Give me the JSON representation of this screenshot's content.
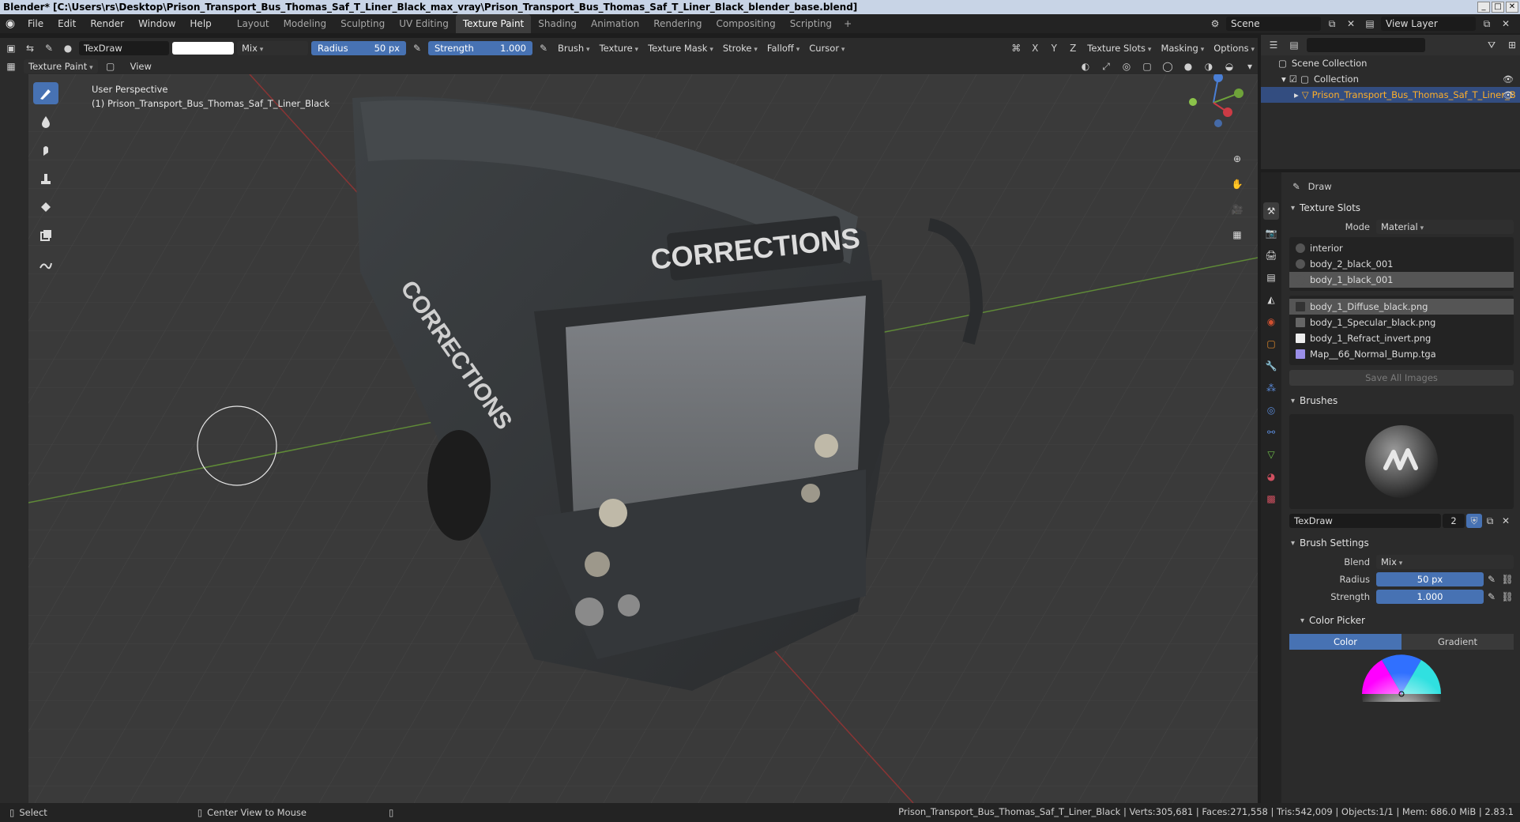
{
  "window": {
    "title": "Blender* [C:\\Users\\rs\\Desktop\\Prison_Transport_Bus_Thomas_Saf_T_Liner_Black_max_vray\\Prison_Transport_Bus_Thomas_Saf_T_Liner_Black_blender_base.blend]"
  },
  "menu": {
    "items": [
      "File",
      "Edit",
      "Render",
      "Window",
      "Help"
    ]
  },
  "workspaces": {
    "tabs": [
      "Layout",
      "Modeling",
      "Sculpting",
      "UV Editing",
      "Texture Paint",
      "Shading",
      "Animation",
      "Rendering",
      "Compositing",
      "Scripting"
    ],
    "active": "Texture Paint",
    "add_label": "+"
  },
  "scene": {
    "name": "Scene",
    "view_layer": "View Layer"
  },
  "toolheader": {
    "brush_name": "TexDraw",
    "blend": "Mix",
    "radius_label": "Radius",
    "radius_value": "50 px",
    "strength_label": "Strength",
    "strength_value": "1.000",
    "menus": [
      "Brush",
      "Texture",
      "Texture Mask",
      "Stroke",
      "Falloff",
      "Cursor"
    ],
    "axes": [
      "X",
      "Y",
      "Z"
    ],
    "right_menus": [
      "Texture Slots",
      "Masking",
      "Options"
    ]
  },
  "toolheader2": {
    "mode": "Texture Paint",
    "view": "View"
  },
  "viewport": {
    "perspective": "User Perspective",
    "object_label": "(1) Prison_Transport_Bus_Thomas_Saf_T_Liner_Black",
    "sign_text": "CORRECTIONS",
    "side_text": "CORRECTIONS"
  },
  "outliner": {
    "scene_collection": "Scene Collection",
    "collection": "Collection",
    "object": "Prison_Transport_Bus_Thomas_Saf_T_Liner_B"
  },
  "properties": {
    "tool_name": "Draw",
    "texture_slots": {
      "title": "Texture Slots",
      "mode_label": "Mode",
      "mode_value": "Material",
      "materials": [
        "interior",
        "body_2_black_001",
        "body_1_black_001"
      ],
      "selected_material": 2,
      "images": [
        "body_1_Diffuse_black.png",
        "body_1_Specular_black.png",
        "body_1_Refract_invert.png",
        "Map__66_Normal_Bump.tga"
      ],
      "selected_image": 0,
      "save_all": "Save All Images"
    },
    "brushes": {
      "title": "Brushes",
      "name": "TexDraw",
      "users": "2"
    },
    "brush_settings": {
      "title": "Brush Settings",
      "blend_label": "Blend",
      "blend_value": "Mix",
      "radius_label": "Radius",
      "radius_value": "50 px",
      "strength_label": "Strength",
      "strength_value": "1.000"
    },
    "color_picker": {
      "title": "Color Picker",
      "tabs": [
        "Color",
        "Gradient"
      ],
      "active_tab": "Color"
    }
  },
  "statusbar": {
    "select": "Select",
    "center": "Center View to Mouse",
    "stats": "Prison_Transport_Bus_Thomas_Saf_T_Liner_Black | Verts:305,681 | Faces:271,558 | Tris:542,009 | Objects:1/1 | Mem: 686.0 MiB | 2.83.1"
  },
  "colors": {
    "accent": "#4772b3",
    "selected_object": "#ffaf29",
    "header": "#2b2b2b",
    "background": "#1d1d1d"
  }
}
